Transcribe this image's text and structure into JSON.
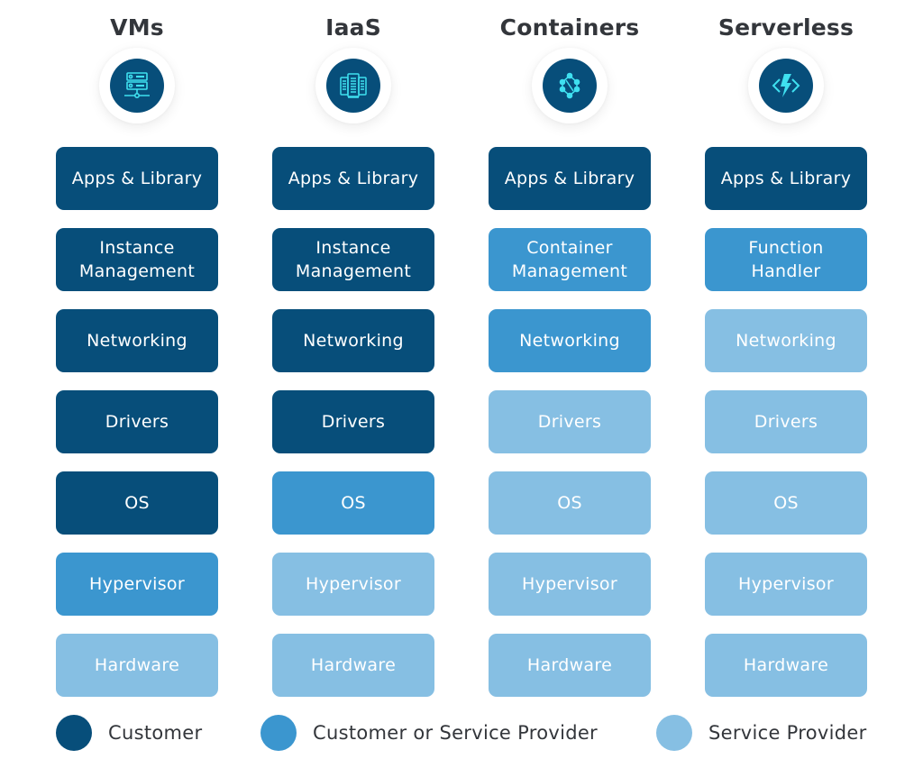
{
  "colors": {
    "customer": "#074e7a",
    "either": "#3b96cf",
    "provider": "#86bfe3",
    "icon_glyph": "#3fe0f0",
    "title_text": "#33363b"
  },
  "columns": [
    {
      "title": "VMs",
      "icon": "server-network-icon",
      "layers": [
        {
          "label": "Apps & Library",
          "owner": "customer"
        },
        {
          "label": "Instance\nManagement",
          "owner": "customer"
        },
        {
          "label": "Networking",
          "owner": "customer"
        },
        {
          "label": "Drivers",
          "owner": "customer"
        },
        {
          "label": "OS",
          "owner": "customer"
        },
        {
          "label": "Hypervisor",
          "owner": "either"
        },
        {
          "label": "Hardware",
          "owner": "provider"
        }
      ]
    },
    {
      "title": "IaaS",
      "icon": "server-rack-icon",
      "layers": [
        {
          "label": "Apps & Library",
          "owner": "customer"
        },
        {
          "label": "Instance\nManagement",
          "owner": "customer"
        },
        {
          "label": "Networking",
          "owner": "customer"
        },
        {
          "label": "Drivers",
          "owner": "customer"
        },
        {
          "label": "OS",
          "owner": "either"
        },
        {
          "label": "Hypervisor",
          "owner": "provider"
        },
        {
          "label": "Hardware",
          "owner": "provider"
        }
      ]
    },
    {
      "title": "Containers",
      "icon": "container-cluster-icon",
      "layers": [
        {
          "label": "Apps & Library",
          "owner": "customer"
        },
        {
          "label": "Container\nManagement",
          "owner": "either"
        },
        {
          "label": "Networking",
          "owner": "either"
        },
        {
          "label": "Drivers",
          "owner": "provider"
        },
        {
          "label": "OS",
          "owner": "provider"
        },
        {
          "label": "Hypervisor",
          "owner": "provider"
        },
        {
          "label": "Hardware",
          "owner": "provider"
        }
      ]
    },
    {
      "title": "Serverless",
      "icon": "function-bolt-icon",
      "layers": [
        {
          "label": "Apps & Library",
          "owner": "customer"
        },
        {
          "label": "Function\nHandler",
          "owner": "either"
        },
        {
          "label": "Networking",
          "owner": "provider"
        },
        {
          "label": "Drivers",
          "owner": "provider"
        },
        {
          "label": "OS",
          "owner": "provider"
        },
        {
          "label": "Hypervisor",
          "owner": "provider"
        },
        {
          "label": "Hardware",
          "owner": "provider"
        }
      ]
    }
  ],
  "legend": [
    {
      "label": "Customer",
      "owner": "customer"
    },
    {
      "label": "Customer or Service Provider",
      "owner": "either"
    },
    {
      "label": "Service Provider",
      "owner": "provider"
    }
  ]
}
